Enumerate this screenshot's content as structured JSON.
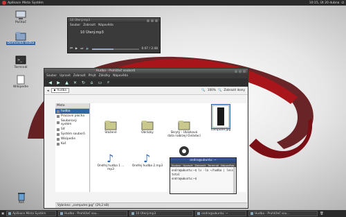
{
  "topbar": {
    "apps_label": "Aplikace",
    "places_label": "Místa",
    "system_label": "Systém",
    "clock": "10:15, Út 20 dubna"
  },
  "desktop": {
    "icons": [
      {
        "label": "Počítač",
        "icon": "computer-icon"
      },
      {
        "label": "Domovská složka",
        "icon": "home-folder-icon"
      },
      {
        "label": "Terminál",
        "icon": "terminal-icon"
      },
      {
        "label": "Wikipedie",
        "icon": "document-icon"
      }
    ],
    "trash_label": "Koš"
  },
  "player": {
    "title": "10 Úterý.mp3",
    "menu": [
      "Soubor",
      "Zobrazit",
      "Nápověda"
    ],
    "track": "10 Úterý.mp3",
    "time": "0:07 / 2:48",
    "progress": 0.45
  },
  "file_manager": {
    "title": "Hudba - Prohlížeč souborů",
    "menu": [
      "Soubor",
      "Upravit",
      "Zobrazit",
      "Přejít",
      "Záložky",
      "Nápověda"
    ],
    "crumb": "hudba",
    "zoom": "100%",
    "view_mode": "Zobrazit ikony",
    "sidebar_header": "Místa",
    "sidebar": [
      "hudba",
      "Pracovní plocha",
      "Souborový systém",
      "Síť",
      "Systém souborů",
      "Wikipedie",
      "Koš"
    ],
    "files": [
      {
        "label": "Stažené",
        "icon": "folder-icon"
      },
      {
        "label": "Obrázky",
        "icon": "folder-icon"
      },
      {
        "label": "Skrytý - Ukázková data nabízejí Ovládací",
        "icon": "folder-icon"
      },
      {
        "label": "computer.jpg",
        "icon": "image-icon"
      },
      {
        "label": "Ondřej hudba 1 ... mp3",
        "icon": "music-icon"
      },
      {
        "label": "Ondřej hudba 2.mp3",
        "icon": "music-icon"
      },
      {
        "label": "",
        "icon": "gear-icon"
      }
    ],
    "status": "Vybráno: „computer.jpg“ (29,2 kB)"
  },
  "terminal": {
    "title": "ondra@ubuntu: ~",
    "menu": [
      "Soubor",
      "Upravit",
      "Zobrazit",
      "Terminál",
      "Nápověda"
    ],
    "lines": [
      "ondra@ubuntu:~$ ls -la ~/hudba | less",
      "total",
      "ondra@ubuntu:~$"
    ]
  },
  "taskbar": {
    "tasks": [
      "Aplikace Místa Systém",
      "Hudba - Prohlížeč sou...",
      "10 Úterý.mp3",
      "ondra@ubuntu: ~",
      "Hudba - Prohlížeč sou..."
    ]
  }
}
